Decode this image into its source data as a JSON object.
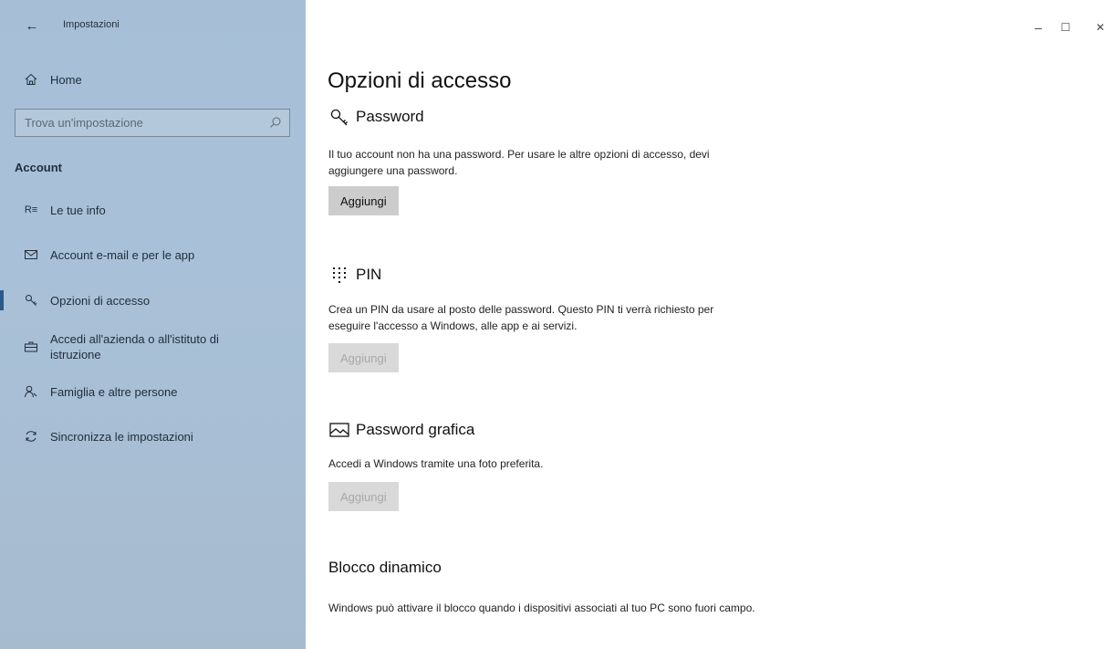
{
  "window": {
    "app_title": "Impostazioni",
    "controls": {
      "minimize": "–",
      "maximize": "☐",
      "close": "✕"
    }
  },
  "sidebar": {
    "home_label": "Home",
    "search": {
      "placeholder": "Trova un'impostazione",
      "value": ""
    },
    "section_header": "Account",
    "items": [
      {
        "label": "Le tue info",
        "icon": "user-info-icon"
      },
      {
        "label": "Account e-mail e per le app",
        "icon": "mail-icon"
      },
      {
        "label": "Opzioni di accesso",
        "icon": "key-icon",
        "active": true
      },
      {
        "label": "Accedi all'azienda o all'istituto di istruzione",
        "icon": "briefcase-icon"
      },
      {
        "label": "Famiglia e altre persone",
        "icon": "people-icon"
      },
      {
        "label": "Sincronizza le impostazioni",
        "icon": "sync-icon"
      }
    ]
  },
  "main": {
    "title": "Opzioni di accesso",
    "sections": [
      {
        "title": "Password",
        "icon": "key-icon",
        "description": "Il tuo account non ha una password. Per usare le altre opzioni di accesso, devi aggiungere una password.",
        "button": "Aggiungi",
        "button_enabled": true
      },
      {
        "title": "PIN",
        "icon": "keypad-icon",
        "description": "Crea un PIN da usare al posto delle password. Questo PIN ti verrà richiesto per eseguire l'accesso a Windows, alle app e ai servizi.",
        "button": "Aggiungi",
        "button_enabled": false
      },
      {
        "title": "Password grafica",
        "icon": "picture-icon",
        "description": "Accedi a Windows tramite una foto preferita.",
        "button": "Aggiungi",
        "button_enabled": false
      },
      {
        "title": "Blocco dinamico",
        "description": "Windows può attivare il blocco quando i dispositivi associati al tuo PC sono fuori campo."
      }
    ]
  }
}
